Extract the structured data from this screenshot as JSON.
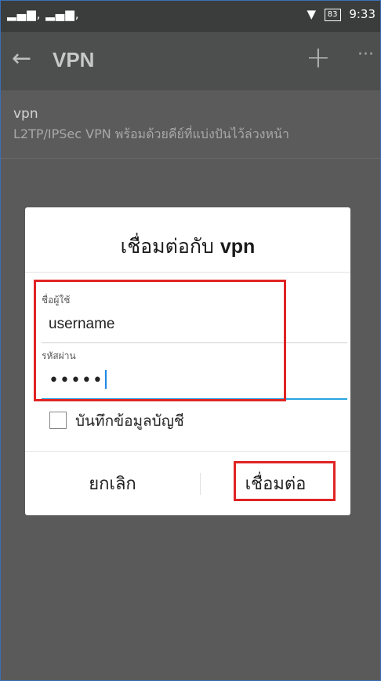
{
  "statusbar": {
    "signal": "▂▄▆, ▂▄▆,",
    "wifi": "▼",
    "battery": "83",
    "time": "9:33"
  },
  "appbar": {
    "back": "←",
    "title": "VPN",
    "add": "+",
    "more": "···"
  },
  "vpn_item": {
    "name": "vpn",
    "description": "L2TP/IPSec VPN พร้อมด้วยคีย์ที่แบ่งปันไว้ล่วงหน้า"
  },
  "dialog": {
    "title_prefix": "เชื่อมต่อกับ",
    "title_name": "vpn",
    "username_label": "ชื่อผู้ใช้",
    "username_value": "username",
    "password_label": "รหัสผ่าน",
    "password_value": "•••••",
    "save_label": "บันทึกข้อมูลบัญชี",
    "cancel": "ยกเลิก",
    "connect": "เชื่อมต่อ"
  },
  "colors": {
    "highlight": "#e02424",
    "accent": "#29a4e0"
  }
}
